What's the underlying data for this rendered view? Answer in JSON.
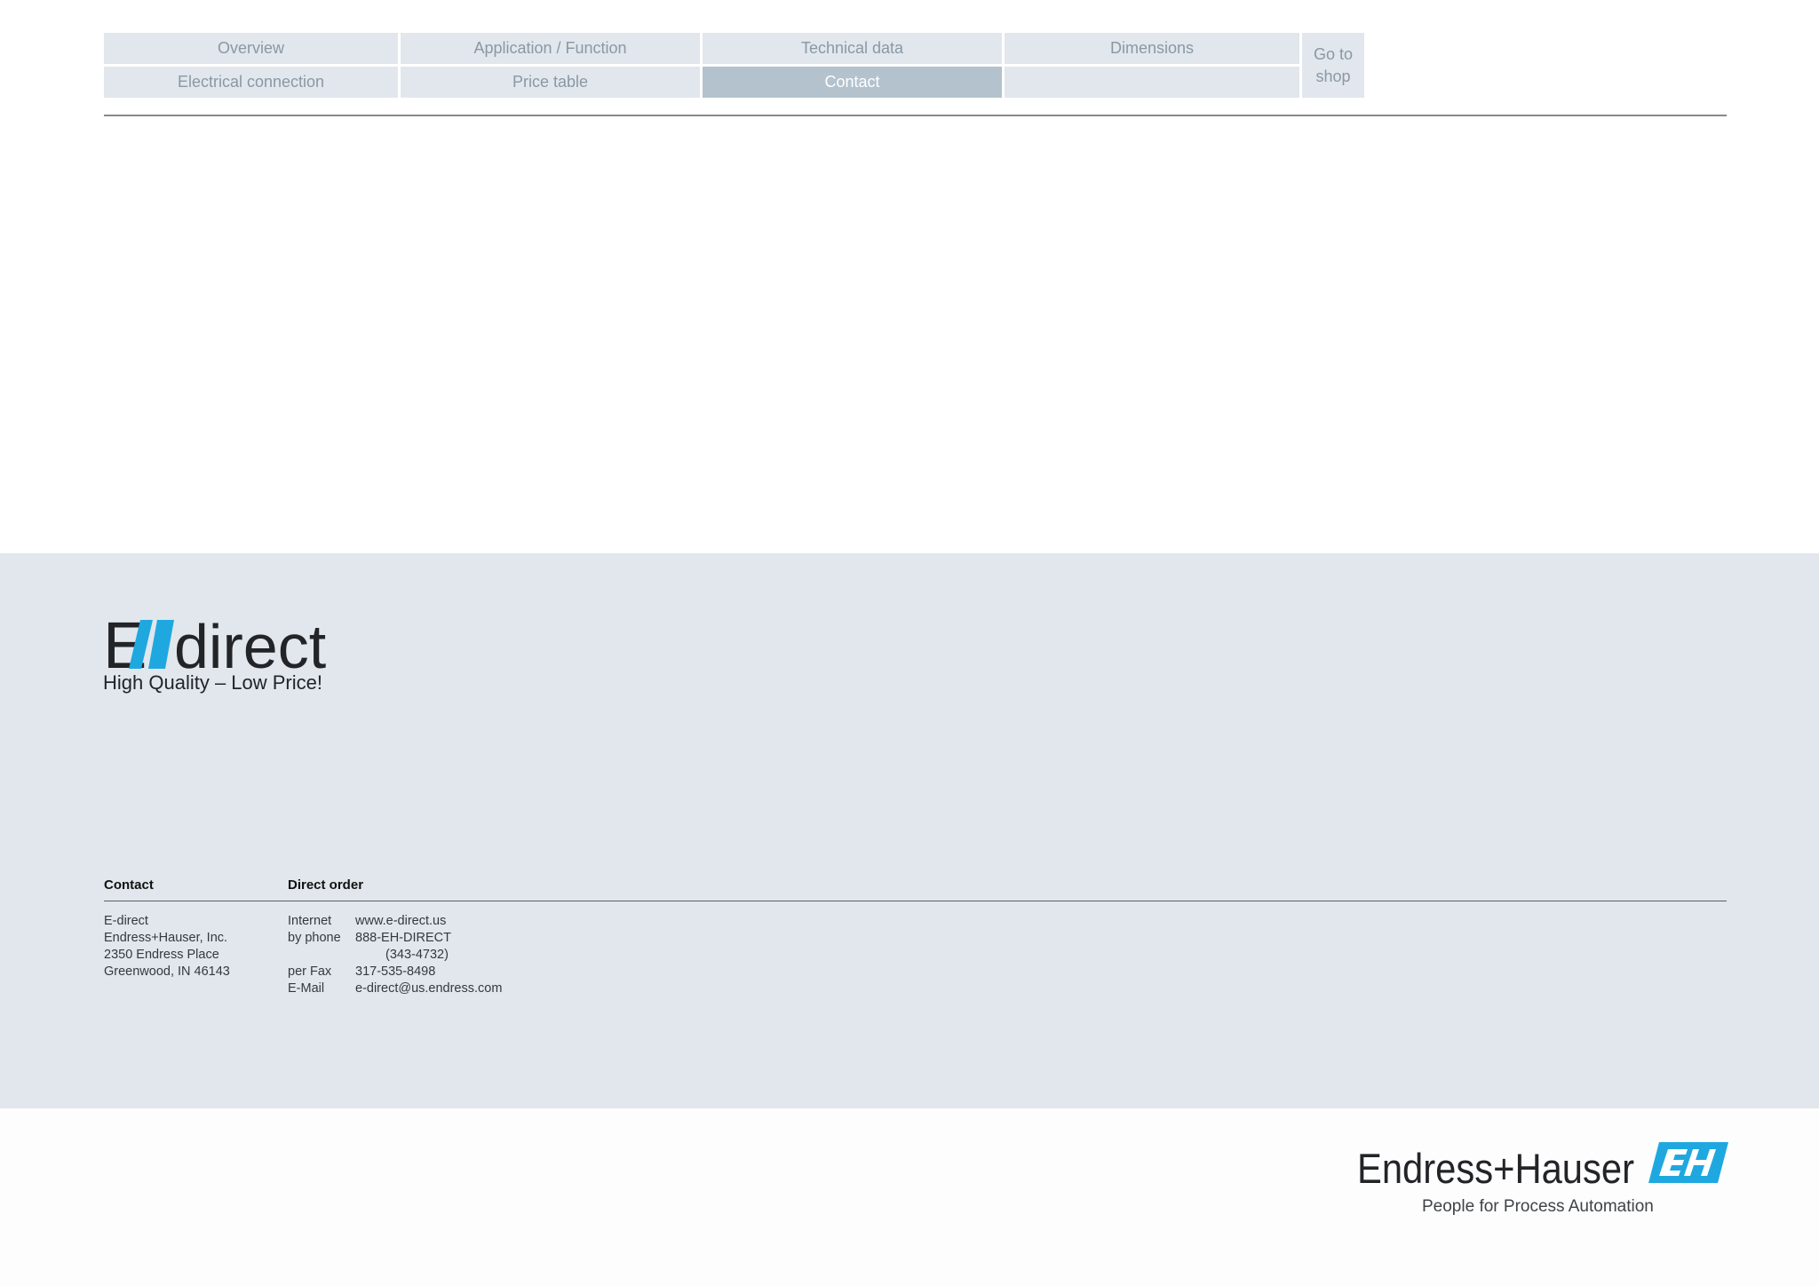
{
  "nav": {
    "items": [
      {
        "label": "Overview"
      },
      {
        "label": "Application / Function"
      },
      {
        "label": "Technical data"
      },
      {
        "label": "Dimensions"
      },
      {
        "label": "Electrical connection"
      },
      {
        "label": "Price table"
      },
      {
        "label": "Contact",
        "active": true
      },
      {
        "label": ""
      }
    ],
    "shop_label": "Go to\nshop"
  },
  "edirect": {
    "logo_text_e": "E",
    "logo_text_direct": "direct",
    "tagline": "High Quality – Low Price!"
  },
  "contact": {
    "heading": "Contact",
    "lines": [
      "E-direct",
      "Endress+Hauser, Inc.",
      "2350 Endress Place",
      "Greenwood, IN 46143"
    ]
  },
  "direct_order": {
    "heading": "Direct order",
    "internet_label": "Internet",
    "internet_value": "www.e-direct.us",
    "phone_label": "by phone",
    "phone_value": "888-EH-DIRECT",
    "phone_value_2": "(343-4732)",
    "fax_label": "per Fax",
    "fax_value": "317-535-8498",
    "email_label": "E-Mail",
    "email_value": "e-direct@us.endress.com"
  },
  "footer": {
    "brand": "Endress+Hauser",
    "tagline": "People for Process Automation"
  },
  "colors": {
    "nav_bg": "#e1e7ec",
    "nav_active_bg": "#b3c2cd",
    "band_bg": "#e1e7ec",
    "brand_blue": "#1fa8e0"
  }
}
